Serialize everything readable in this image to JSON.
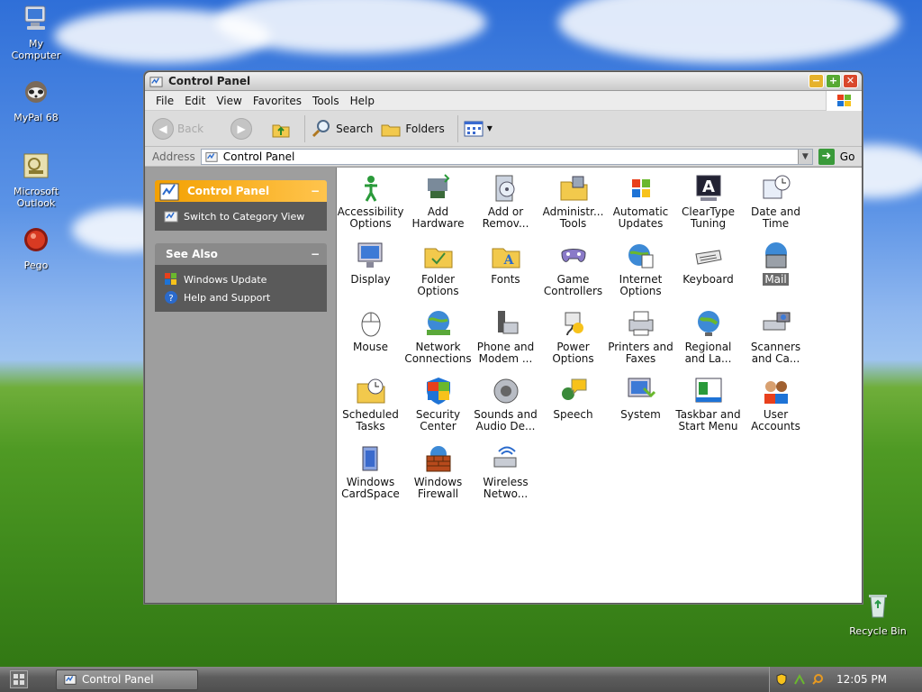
{
  "desktop": {
    "icons": [
      {
        "label": "My\nComputer",
        "icon": "my-computer-icon"
      },
      {
        "label": "MyPal 68",
        "icon": "mypal-icon"
      },
      {
        "label": "Microsoft\nOutlook",
        "icon": "outlook-icon"
      },
      {
        "label": "Pego",
        "icon": "pego-icon"
      },
      {
        "label": "Recycle Bin",
        "icon": "recycle-bin-icon"
      }
    ]
  },
  "window": {
    "title": "Control Panel",
    "menu": [
      "File",
      "Edit",
      "View",
      "Favorites",
      "Tools",
      "Help"
    ],
    "toolbar": {
      "back": "Back",
      "search": "Search",
      "folders": "Folders"
    },
    "address": {
      "label": "Address",
      "value": "Control Panel",
      "go": "Go"
    },
    "sidebar": {
      "panel1": {
        "title": "Control Panel",
        "links": [
          "Switch to Category View"
        ]
      },
      "panel2": {
        "title": "See Also",
        "links": [
          "Windows Update",
          "Help and Support"
        ]
      }
    },
    "items": [
      {
        "label": "Accessibility Options",
        "icon": "accessibility-icon"
      },
      {
        "label": "Add Hardware",
        "icon": "add-hardware-icon"
      },
      {
        "label": "Add or Remov...",
        "icon": "add-remove-icon"
      },
      {
        "label": "Administr... Tools",
        "icon": "admin-tools-icon"
      },
      {
        "label": "Automatic Updates",
        "icon": "auto-updates-icon"
      },
      {
        "label": "ClearType Tuning",
        "icon": "cleartype-icon"
      },
      {
        "label": "Date and Time",
        "icon": "date-time-icon"
      },
      {
        "label": "Display",
        "icon": "display-icon"
      },
      {
        "label": "Folder Options",
        "icon": "folder-options-icon"
      },
      {
        "label": "Fonts",
        "icon": "fonts-icon"
      },
      {
        "label": "Game Controllers",
        "icon": "game-controllers-icon"
      },
      {
        "label": "Internet Options",
        "icon": "internet-options-icon"
      },
      {
        "label": "Keyboard",
        "icon": "keyboard-icon"
      },
      {
        "label": "Mail",
        "icon": "mail-icon"
      },
      {
        "label": "Mouse",
        "icon": "mouse-icon"
      },
      {
        "label": "Network Connections",
        "icon": "network-icon"
      },
      {
        "label": "Phone and Modem ...",
        "icon": "phone-modem-icon"
      },
      {
        "label": "Power Options",
        "icon": "power-icon"
      },
      {
        "label": "Printers and Faxes",
        "icon": "printers-icon"
      },
      {
        "label": "Regional and La...",
        "icon": "regional-icon"
      },
      {
        "label": "Scanners and Ca...",
        "icon": "scanners-icon"
      },
      {
        "label": "Scheduled Tasks",
        "icon": "scheduled-tasks-icon"
      },
      {
        "label": "Security Center",
        "icon": "security-center-icon"
      },
      {
        "label": "Sounds and Audio De...",
        "icon": "sounds-icon"
      },
      {
        "label": "Speech",
        "icon": "speech-icon"
      },
      {
        "label": "System",
        "icon": "system-icon"
      },
      {
        "label": "Taskbar and Start Menu",
        "icon": "taskbar-icon"
      },
      {
        "label": "User Accounts",
        "icon": "user-accounts-icon"
      },
      {
        "label": "Windows CardSpace",
        "icon": "cardspace-icon"
      },
      {
        "label": "Windows Firewall",
        "icon": "firewall-icon"
      },
      {
        "label": "Wireless Netwo...",
        "icon": "wireless-icon"
      }
    ],
    "selected_item": "Mail"
  },
  "taskbar": {
    "task": "Control Panel",
    "clock": "12:05 PM"
  }
}
